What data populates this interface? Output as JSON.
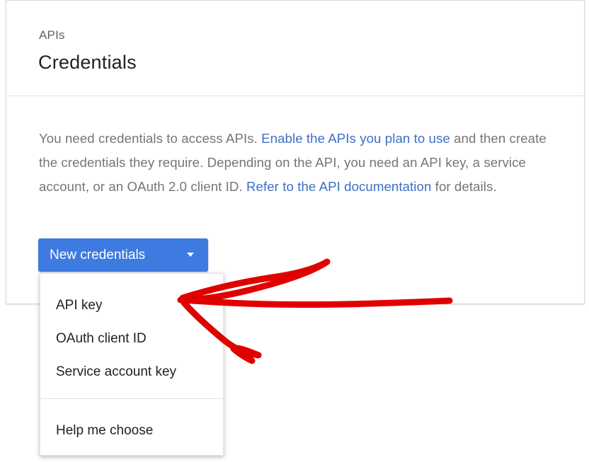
{
  "header": {
    "eyebrow": "APIs",
    "title": "Credentials"
  },
  "description": {
    "part1": "You need credentials to access APIs. ",
    "link1": "Enable the APIs you plan to use",
    "part2": " and then create the credentials they require. Depending on the API, you need an API key, a service account, or an OAuth 2.0 client ID. ",
    "link2": "Refer to the API documentation",
    "part3": " for details."
  },
  "new_credentials": {
    "label": "New credentials"
  },
  "menu": {
    "items": [
      {
        "label": "API key"
      },
      {
        "label": "OAuth client ID"
      },
      {
        "label": "Service account key"
      }
    ],
    "help_label": "Help me choose"
  },
  "colors": {
    "accent": "#3d7be0",
    "link": "#3b6fc4",
    "annotation": "#e00000"
  }
}
